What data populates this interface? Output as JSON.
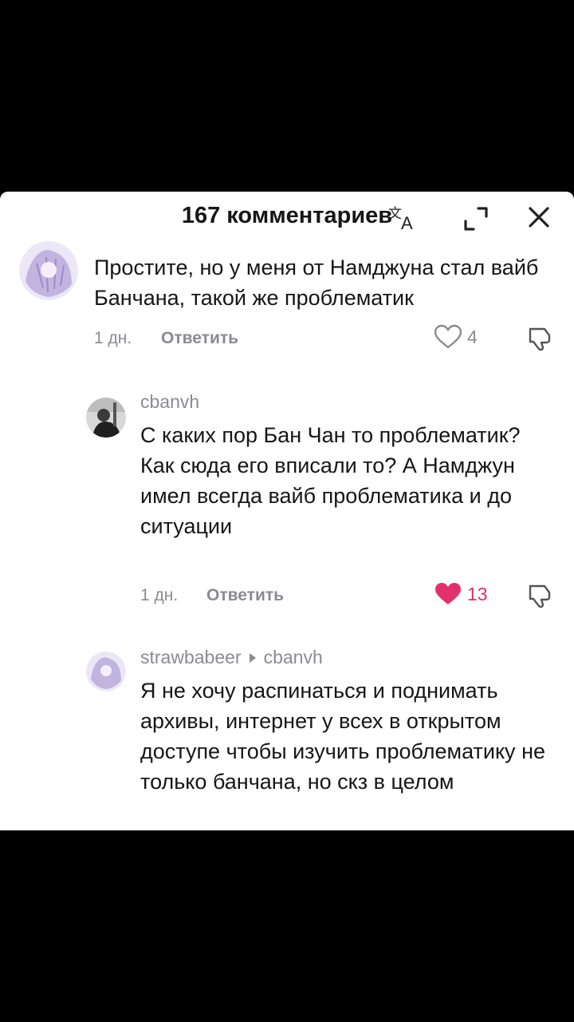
{
  "header": {
    "title": "167 комментариев",
    "icons": [
      "translate-icon",
      "expand-icon",
      "close-icon"
    ]
  },
  "comments": [
    {
      "text": "Простите, но у меня от Намджуна стал вайб Банчана, такой же проблематик",
      "time": "1 дн.",
      "reply_label": "Ответить",
      "likes": "4",
      "liked": false
    },
    {
      "username": "cbanvh",
      "text": "С каких пор Бан Чан то проблематик? Как сюда его вписали то? А Намджун имел всегда вайб проблематика и до ситуации",
      "time": "1 дн.",
      "reply_label": "Ответить",
      "likes": "13",
      "liked": true
    },
    {
      "username": "strawbabeer",
      "reply_to": "cbanvh",
      "text": "Я не хочу распинаться и поднимать архивы, интернет у всех в открытом доступе чтобы изучить проблематику не только банчана, но скз в целом"
    }
  ],
  "colors": {
    "liked": "#e1306c",
    "muted": "#8a8b91",
    "text": "#161616"
  }
}
